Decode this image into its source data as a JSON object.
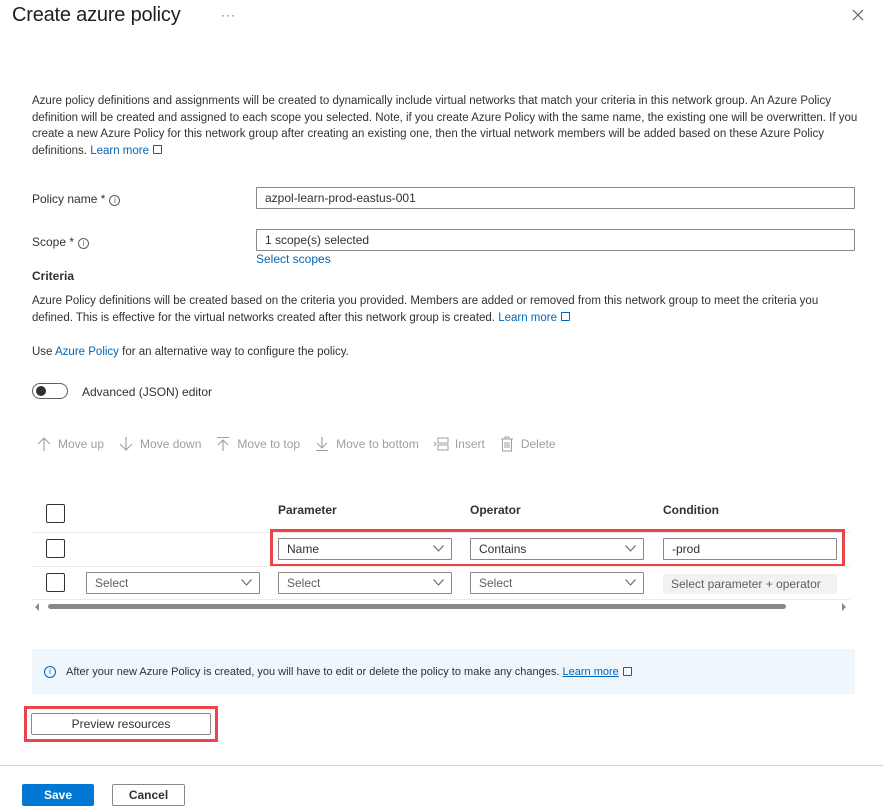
{
  "header": {
    "title": "Create azure policy",
    "more_label": "···",
    "close_icon": "close-icon"
  },
  "intro": {
    "text": "Azure policy definitions and assignments will be created to dynamically include virtual networks that match your criteria in this network group. An Azure Policy definition will be created and assigned to each scope you selected. Note, if you create Azure Policy with the same name, the existing one will be overwritten. If you create a new Azure Policy for this network group after creating an existing one, then the virtual network members will be added based on these Azure Policy definitions.",
    "learn_more": "Learn more"
  },
  "form": {
    "policy_name": {
      "label": "Policy name *",
      "value": "azpol-learn-prod-eastus-001"
    },
    "scope": {
      "label": "Scope *",
      "value": "1 scope(s) selected",
      "link": "Select scopes"
    }
  },
  "criteria": {
    "heading": "Criteria",
    "description": "Azure Policy definitions will be created based on the criteria you provided. Members are added or removed from this network group to meet the criteria you defined. This is effective for the virtual networks created after this network group is created.",
    "learn_more": "Learn more",
    "alt_prefix": "Use",
    "alt_link": "Azure Policy",
    "alt_suffix": "for an alternative way to configure the policy.",
    "toggle_label": "Advanced (JSON) editor",
    "toggle_on": false
  },
  "toolbar": {
    "items": [
      {
        "label": "Move up",
        "icon": "arrow-up-icon",
        "enabled": false
      },
      {
        "label": "Move down",
        "icon": "arrow-down-icon",
        "enabled": false
      },
      {
        "label": "Move to top",
        "icon": "move-to-top-icon",
        "enabled": false
      },
      {
        "label": "Move to bottom",
        "icon": "move-to-bottom-icon",
        "enabled": false
      },
      {
        "label": "Insert",
        "icon": "insert-icon",
        "enabled": false
      },
      {
        "label": "Delete",
        "icon": "delete-icon",
        "enabled": false
      }
    ]
  },
  "grid": {
    "columns": [
      "",
      "Parameter",
      "Operator",
      "Condition"
    ],
    "rows": [
      {
        "logic": "",
        "parameter": "Name",
        "operator": "Contains",
        "condition": "-prod"
      },
      {
        "logic": "Select",
        "parameter": "Select",
        "operator": "Select",
        "condition": "Select parameter + operator"
      }
    ]
  },
  "info_bar": {
    "text": "After your new Azure Policy is created, you will have to edit or delete the policy to make any changes.",
    "learn_more": "Learn more"
  },
  "actions": {
    "preview": "Preview resources",
    "save": "Save",
    "cancel": "Cancel"
  },
  "colors": {
    "primary": "#0078d4",
    "link": "#0066b8",
    "highlight": "#e8444a",
    "info_bg": "#eff6fc"
  }
}
